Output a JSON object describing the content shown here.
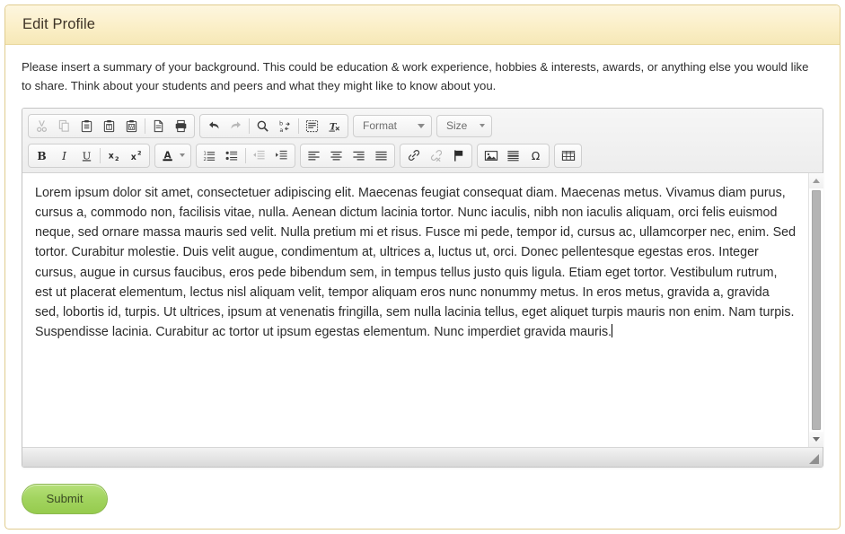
{
  "header": {
    "title": "Edit Profile"
  },
  "instructions": {
    "text": "Please insert a summary of your background. This could be education & work experience, hobbies & interests, awards, or anything else you would like to share. Think about your students and peers and what they might like to know about you."
  },
  "editor": {
    "toolbar": {
      "row1": [
        {
          "group": [
            {
              "name": "cut-icon",
              "label": "Cut",
              "disabled": true
            },
            {
              "name": "copy-icon",
              "label": "Copy",
              "disabled": true
            },
            {
              "name": "paste-icon",
              "label": "Paste",
              "disabled": false
            },
            {
              "name": "paste-as-plain-text-icon",
              "label": "Paste as plain text",
              "disabled": false
            },
            {
              "name": "paste-from-word-icon",
              "label": "Paste from Word",
              "disabled": false
            },
            {
              "name": "separator",
              "label": "",
              "disabled": false
            },
            {
              "name": "new-page-icon",
              "label": "New Page",
              "disabled": false
            },
            {
              "name": "print-icon",
              "label": "Print",
              "disabled": false
            }
          ]
        },
        {
          "group": [
            {
              "name": "undo-icon",
              "label": "Undo",
              "disabled": false
            },
            {
              "name": "redo-icon",
              "label": "Redo",
              "disabled": true
            },
            {
              "name": "separator",
              "label": "",
              "disabled": false
            },
            {
              "name": "find-icon",
              "label": "Find",
              "disabled": false
            },
            {
              "name": "replace-icon",
              "label": "Replace",
              "disabled": false
            },
            {
              "name": "separator",
              "label": "",
              "disabled": false
            },
            {
              "name": "select-all-icon",
              "label": "Select All",
              "disabled": false
            },
            {
              "name": "remove-format-icon",
              "label": "Remove Format",
              "disabled": false
            }
          ]
        }
      ],
      "format_combo": {
        "label": "Format"
      },
      "size_combo": {
        "label": "Size"
      },
      "row2": [
        {
          "group": [
            {
              "name": "bold-icon",
              "label": "Bold",
              "disabled": false
            },
            {
              "name": "italic-icon",
              "label": "Italic",
              "disabled": false
            },
            {
              "name": "underline-icon",
              "label": "Underline",
              "disabled": false
            },
            {
              "name": "separator",
              "label": "",
              "disabled": false
            },
            {
              "name": "subscript-icon",
              "label": "Subscript",
              "disabled": false
            },
            {
              "name": "superscript-icon",
              "label": "Superscript",
              "disabled": false
            }
          ]
        },
        {
          "group": [
            {
              "name": "text-color-icon",
              "label": "Text Color",
              "disabled": false
            }
          ]
        },
        {
          "group": [
            {
              "name": "numbered-list-icon",
              "label": "Insert/Remove Numbered List",
              "disabled": false
            },
            {
              "name": "bulleted-list-icon",
              "label": "Insert/Remove Bulleted List",
              "disabled": false
            },
            {
              "name": "separator",
              "label": "",
              "disabled": false
            },
            {
              "name": "outdent-icon",
              "label": "Decrease Indent",
              "disabled": true
            },
            {
              "name": "indent-icon",
              "label": "Increase Indent",
              "disabled": false
            }
          ]
        },
        {
          "group": [
            {
              "name": "align-left-icon",
              "label": "Align Left",
              "disabled": false
            },
            {
              "name": "align-center-icon",
              "label": "Center",
              "disabled": false
            },
            {
              "name": "align-right-icon",
              "label": "Align Right",
              "disabled": false
            },
            {
              "name": "justify-icon",
              "label": "Justify",
              "disabled": false
            }
          ]
        },
        {
          "group": [
            {
              "name": "link-icon",
              "label": "Link",
              "disabled": false
            },
            {
              "name": "unlink-icon",
              "label": "Unlink",
              "disabled": true
            },
            {
              "name": "anchor-icon",
              "label": "Anchor",
              "disabled": false
            }
          ]
        },
        {
          "group": [
            {
              "name": "image-icon",
              "label": "Image",
              "disabled": false
            },
            {
              "name": "horizontal-rule-icon",
              "label": "Horizontal Line",
              "disabled": false
            },
            {
              "name": "special-character-icon",
              "label": "Insert Special Character",
              "disabled": false
            }
          ]
        },
        {
          "group": [
            {
              "name": "table-icon",
              "label": "Table",
              "disabled": false
            }
          ]
        }
      ]
    },
    "content": {
      "body": "Lorem ipsum dolor sit amet, consectetuer adipiscing elit. Maecenas feugiat consequat diam. Maecenas metus. Vivamus diam purus, cursus a, commodo non, facilisis vitae, nulla. Aenean dictum lacinia tortor. Nunc iaculis, nibh non iaculis aliquam, orci felis euismod neque, sed ornare massa mauris sed velit. Nulla pretium mi et risus. Fusce mi pede, tempor id, cursus ac, ullamcorper nec, enim. Sed tortor. Curabitur molestie. Duis velit augue, condimentum at, ultrices a, luctus ut, orci. Donec pellentesque egestas eros. Integer cursus, augue in cursus faucibus, eros pede bibendum sem, in tempus tellus justo quis ligula. Etiam eget tortor. Vestibulum rutrum, est ut placerat elementum, lectus nisl aliquam velit, tempor aliquam eros nunc nonummy metus. In eros metus, gravida a, gravida sed, lobortis id, turpis. Ut ultrices, ipsum at venenatis fringilla, sem nulla lacinia tellus, eget aliquet turpis mauris non enim. Nam turpis. Suspendisse lacinia. Curabitur ac tortor ut ipsum egestas elementum. Nunc imperdiet gravida mauris."
    },
    "scrollbar": {
      "name": "vertical-scrollbar"
    },
    "resize_grip": {
      "name": "resize-grip"
    }
  },
  "footer": {
    "submit_label": "Submit"
  },
  "colors": {
    "header_bg": "#fbefc8",
    "panel_border": "#e0cc8f",
    "submit_green": "#a2d45f",
    "toolbar_bg": "#f1f1f1"
  }
}
